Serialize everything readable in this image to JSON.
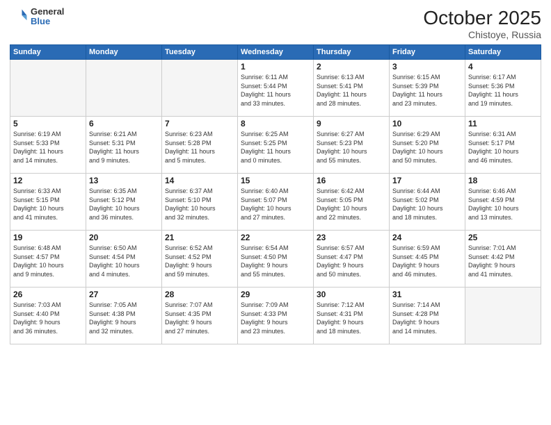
{
  "header": {
    "logo_general": "General",
    "logo_blue": "Blue",
    "month": "October 2025",
    "location": "Chistoye, Russia"
  },
  "weekdays": [
    "Sunday",
    "Monday",
    "Tuesday",
    "Wednesday",
    "Thursday",
    "Friday",
    "Saturday"
  ],
  "weeks": [
    [
      {
        "day": "",
        "info": ""
      },
      {
        "day": "",
        "info": ""
      },
      {
        "day": "",
        "info": ""
      },
      {
        "day": "1",
        "info": "Sunrise: 6:11 AM\nSunset: 5:44 PM\nDaylight: 11 hours\nand 33 minutes."
      },
      {
        "day": "2",
        "info": "Sunrise: 6:13 AM\nSunset: 5:41 PM\nDaylight: 11 hours\nand 28 minutes."
      },
      {
        "day": "3",
        "info": "Sunrise: 6:15 AM\nSunset: 5:39 PM\nDaylight: 11 hours\nand 23 minutes."
      },
      {
        "day": "4",
        "info": "Sunrise: 6:17 AM\nSunset: 5:36 PM\nDaylight: 11 hours\nand 19 minutes."
      }
    ],
    [
      {
        "day": "5",
        "info": "Sunrise: 6:19 AM\nSunset: 5:33 PM\nDaylight: 11 hours\nand 14 minutes."
      },
      {
        "day": "6",
        "info": "Sunrise: 6:21 AM\nSunset: 5:31 PM\nDaylight: 11 hours\nand 9 minutes."
      },
      {
        "day": "7",
        "info": "Sunrise: 6:23 AM\nSunset: 5:28 PM\nDaylight: 11 hours\nand 5 minutes."
      },
      {
        "day": "8",
        "info": "Sunrise: 6:25 AM\nSunset: 5:25 PM\nDaylight: 11 hours\nand 0 minutes."
      },
      {
        "day": "9",
        "info": "Sunrise: 6:27 AM\nSunset: 5:23 PM\nDaylight: 10 hours\nand 55 minutes."
      },
      {
        "day": "10",
        "info": "Sunrise: 6:29 AM\nSunset: 5:20 PM\nDaylight: 10 hours\nand 50 minutes."
      },
      {
        "day": "11",
        "info": "Sunrise: 6:31 AM\nSunset: 5:17 PM\nDaylight: 10 hours\nand 46 minutes."
      }
    ],
    [
      {
        "day": "12",
        "info": "Sunrise: 6:33 AM\nSunset: 5:15 PM\nDaylight: 10 hours\nand 41 minutes."
      },
      {
        "day": "13",
        "info": "Sunrise: 6:35 AM\nSunset: 5:12 PM\nDaylight: 10 hours\nand 36 minutes."
      },
      {
        "day": "14",
        "info": "Sunrise: 6:37 AM\nSunset: 5:10 PM\nDaylight: 10 hours\nand 32 minutes."
      },
      {
        "day": "15",
        "info": "Sunrise: 6:40 AM\nSunset: 5:07 PM\nDaylight: 10 hours\nand 27 minutes."
      },
      {
        "day": "16",
        "info": "Sunrise: 6:42 AM\nSunset: 5:05 PM\nDaylight: 10 hours\nand 22 minutes."
      },
      {
        "day": "17",
        "info": "Sunrise: 6:44 AM\nSunset: 5:02 PM\nDaylight: 10 hours\nand 18 minutes."
      },
      {
        "day": "18",
        "info": "Sunrise: 6:46 AM\nSunset: 4:59 PM\nDaylight: 10 hours\nand 13 minutes."
      }
    ],
    [
      {
        "day": "19",
        "info": "Sunrise: 6:48 AM\nSunset: 4:57 PM\nDaylight: 10 hours\nand 9 minutes."
      },
      {
        "day": "20",
        "info": "Sunrise: 6:50 AM\nSunset: 4:54 PM\nDaylight: 10 hours\nand 4 minutes."
      },
      {
        "day": "21",
        "info": "Sunrise: 6:52 AM\nSunset: 4:52 PM\nDaylight: 9 hours\nand 59 minutes."
      },
      {
        "day": "22",
        "info": "Sunrise: 6:54 AM\nSunset: 4:50 PM\nDaylight: 9 hours\nand 55 minutes."
      },
      {
        "day": "23",
        "info": "Sunrise: 6:57 AM\nSunset: 4:47 PM\nDaylight: 9 hours\nand 50 minutes."
      },
      {
        "day": "24",
        "info": "Sunrise: 6:59 AM\nSunset: 4:45 PM\nDaylight: 9 hours\nand 46 minutes."
      },
      {
        "day": "25",
        "info": "Sunrise: 7:01 AM\nSunset: 4:42 PM\nDaylight: 9 hours\nand 41 minutes."
      }
    ],
    [
      {
        "day": "26",
        "info": "Sunrise: 7:03 AM\nSunset: 4:40 PM\nDaylight: 9 hours\nand 36 minutes."
      },
      {
        "day": "27",
        "info": "Sunrise: 7:05 AM\nSunset: 4:38 PM\nDaylight: 9 hours\nand 32 minutes."
      },
      {
        "day": "28",
        "info": "Sunrise: 7:07 AM\nSunset: 4:35 PM\nDaylight: 9 hours\nand 27 minutes."
      },
      {
        "day": "29",
        "info": "Sunrise: 7:09 AM\nSunset: 4:33 PM\nDaylight: 9 hours\nand 23 minutes."
      },
      {
        "day": "30",
        "info": "Sunrise: 7:12 AM\nSunset: 4:31 PM\nDaylight: 9 hours\nand 18 minutes."
      },
      {
        "day": "31",
        "info": "Sunrise: 7:14 AM\nSunset: 4:28 PM\nDaylight: 9 hours\nand 14 minutes."
      },
      {
        "day": "",
        "info": ""
      }
    ]
  ]
}
